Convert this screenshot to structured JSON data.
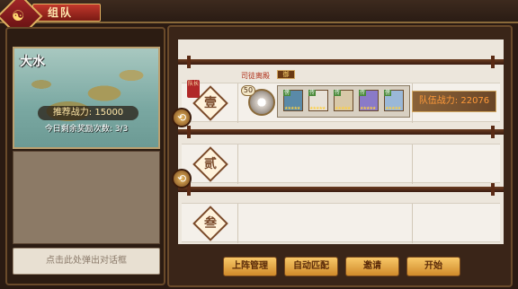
{
  "header": {
    "title": "组队"
  },
  "map": {
    "name": "大水",
    "recommended_power": "推荐战力: 15000",
    "reward_count": "今日剩余奖励次数: 3/3"
  },
  "chat": {
    "placeholder": "点击此处弹出对话框"
  },
  "slots": [
    {
      "number": "壹",
      "captain_tag": "队长",
      "assign_label": "司徒离殿",
      "lock_tag": "御",
      "leader_level": "50",
      "team_power": "队伍战力: 22076",
      "shikigami": [
        {
          "rank": "傍",
          "color": "#5a8aa8"
        },
        {
          "rank": "传",
          "color": "#e8e2d8"
        },
        {
          "rank": "传",
          "color": "#d8c8a8"
        },
        {
          "rank": "传",
          "color": "#8a7ac8"
        },
        {
          "rank": "傍",
          "color": "#9ab8d8"
        }
      ]
    },
    {
      "number": "贰"
    },
    {
      "number": "叁"
    }
  ],
  "buttons": {
    "lineup": "上阵管理",
    "auto_match": "自动匹配",
    "invite": "邀请",
    "start": "开始"
  },
  "icons": {
    "swap": "swap-arrows-icon",
    "emblem": "team-emblem-icon"
  }
}
